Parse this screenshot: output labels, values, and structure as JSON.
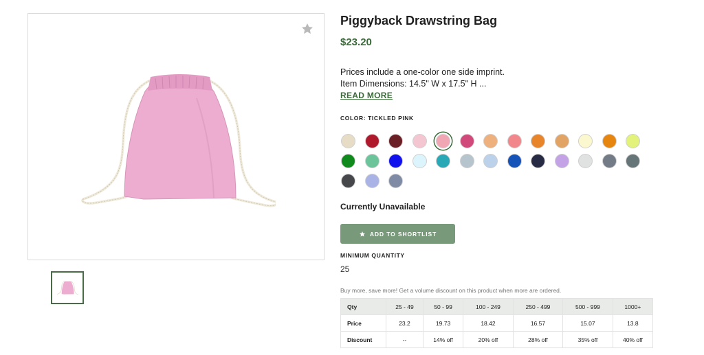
{
  "product": {
    "title": "Piggyback Drawstring Bag",
    "price": "$23.20",
    "description_line1": "Prices include a one-color one side imprint.",
    "description_line2": "Item Dimensions: 14.5\" W x 17.5\" H ...",
    "read_more": "READ MORE",
    "color_label": "COLOR: TICKLED PINK",
    "availability": "Currently Unavailable",
    "shortlist_button": "ADD TO SHORTLIST",
    "min_qty_label": "MINIMUM QUANTITY",
    "min_qty_value": "25",
    "volume_note": "Buy more, save more! Get a volume discount on this product when more are ordered."
  },
  "colors": {
    "selected_index": 4,
    "swatches": [
      "#e7dcc6",
      "#b0192c",
      "#6a1f24",
      "#f4c6d2",
      "#f1a6b4",
      "#d1487a",
      "#eeb07c",
      "#f2878b",
      "#e8842a",
      "#e1a464",
      "#fbf7cf",
      "#e7860f",
      "#e3f27a",
      "#118a1d",
      "#6cc49a",
      "#1111ee",
      "#dcf4fb",
      "#29a9b6",
      "#b6c4cd",
      "#bcd2ea",
      "#1553b8",
      "#272c44",
      "#c3a2e6",
      "#e0e1e1",
      "#727b86",
      "#667577",
      "#45474b",
      "#a9b3e6",
      "#7f8aa4"
    ],
    "accent": "#3a6b39",
    "product_pink": "#ecadd0"
  },
  "pricing_table": {
    "headers": [
      "Qty",
      "25 - 49",
      "50 - 99",
      "100 - 249",
      "250 - 499",
      "500 - 999",
      "1000+"
    ],
    "rows": [
      [
        "Price",
        "23.2",
        "19.73",
        "18.42",
        "16.57",
        "15.07",
        "13.8"
      ],
      [
        "Discount",
        "--",
        "14% off",
        "20% off",
        "28% off",
        "35% off",
        "40% off"
      ]
    ]
  }
}
